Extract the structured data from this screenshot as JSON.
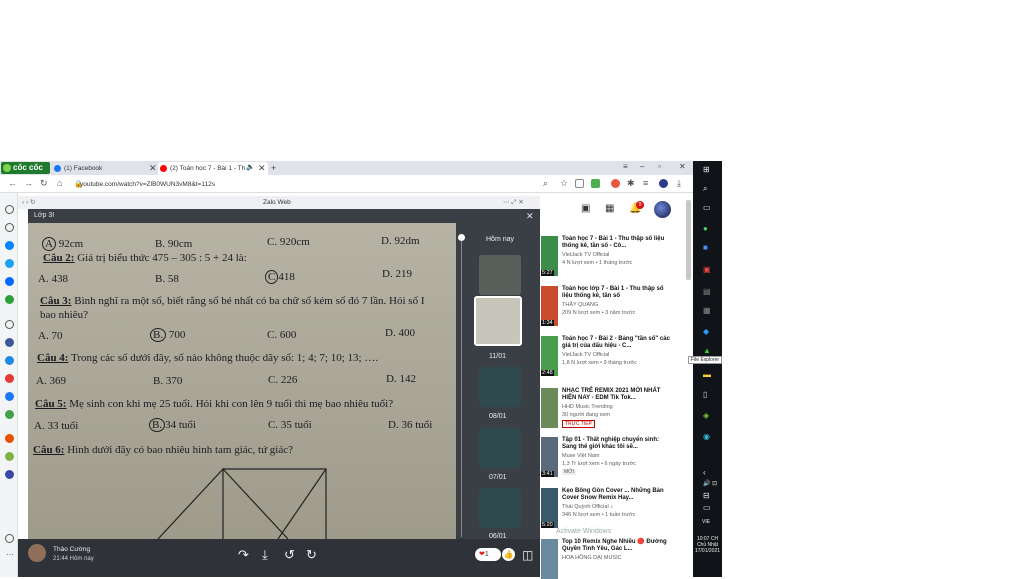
{
  "browser": {
    "brand": "cốc cốc",
    "tabs": [
      {
        "label": "(1) Facebook",
        "color": "#1877f2"
      },
      {
        "label": "(2) Toán học 7 - Bài 1 - Th",
        "color": "#ff0000"
      }
    ],
    "url": "youtube.com/watch?v=ZlB0WUN3vM8&t=112s"
  },
  "zalo": {
    "window_title": "Zalo Web",
    "conversation_title": "Lớp 3I",
    "sender": "Thảo Cường",
    "time": "21:44 Hôm nay",
    "reaction_count": "1",
    "thumb_header": "Hôm nay",
    "thumb_dates": [
      "11/01",
      "08/01",
      "07/01",
      "06/01"
    ]
  },
  "worksheet": {
    "row0": [
      "92cm",
      "B. 90cm",
      "C. 920cm",
      "D. 92dm"
    ],
    "q2_label": "Câu 2:",
    "q2_text": "Giá trị biểu thức 475 – 305 : 5 + 24 là:",
    "q2_opts": [
      "A. 438",
      "B. 58",
      "418",
      "D. 219"
    ],
    "q3_label": "Câu 3:",
    "q3_text": "Bình nghĩ ra một số, biết rằng số bé nhất có ba chữ số kém số đó 7 lần. Hỏi số I",
    "q3_text2": "bao nhiêu?",
    "q3_opts": [
      "A. 70",
      "700",
      "C. 600",
      "D. 400"
    ],
    "q4_label": "Câu 4:",
    "q4_text": "Trong các số dưới đây, số nào không thuộc dãy số: 1; 4; 7; 10; 13; ….",
    "q4_opts": [
      "A. 369",
      "B.  370",
      "C. 226",
      "D. 142"
    ],
    "q5_label": "Câu 5:",
    "q5_text": "Mẹ sinh con khi mẹ 25 tuổi. Hỏi khi con lên 9 tuổi thì mẹ bao nhiêu tuổi?",
    "q5_opts": [
      "A. 33 tuổi",
      "34 tuổi",
      "C. 35 tuổi",
      "D. 36 tuổi"
    ],
    "q6_label": "Câu 6:",
    "q6_text": "Hình dưới đây có bao nhiêu hình tam giác, tứ giác?"
  },
  "youtube": {
    "videos": [
      {
        "title": "Toán học 7 - Bài 1 - Thu thập số liệu thống kê, tần số - Cô...",
        "channel": "VietJack TV Official",
        "meta": "4 N lượt xem • 1 tháng trước",
        "duration": "5:27"
      },
      {
        "title": "Toán học lớp 7 - Bài 1 - Thu thập số liệu thống kê, tần số",
        "channel": "THẦY QUANG",
        "meta": "209 N lượt xem • 3 năm trước",
        "duration": "1:34"
      },
      {
        "title": "Toán học 7 - Bài 2 - Bảng \"tần số\" các giá trị của dấu hiệu - C...",
        "channel": "VietJack TV Official",
        "meta": "1,8 N lượt xem • 9 tháng trước",
        "duration": "2:48"
      },
      {
        "title": "NHẠC TRẺ REMIX 2021 MỚI NHẤT HIỆN NAY - EDM Tik Tok...",
        "channel": "HHD Music Trending",
        "meta": "30 người đang xem",
        "badge": "TRỰC TIẾP"
      },
      {
        "title": "Tập 01 - Thất nghiệp chuyển sinh: Sang thế giới khác tôi sẽ...",
        "channel": "Muse Việt Nam",
        "meta": "1,3 Tr lượt xem • 6 ngày trước",
        "badge": "MỚI",
        "duration": "3:41"
      },
      {
        "title": "Kẹo Bông Gòn Cover ... Những Bản Cover Snow Remix Hay...",
        "channel": "Thái Quỳnh Official ♪",
        "meta": "346 N lượt xem • 1 tuần trước",
        "duration": "5:20"
      },
      {
        "title": "Top 10 Remix Nghe Nhiều 🔴 Đường Quyền Tình Yêu, Gác L...",
        "channel": "HOA HỒNG DẠI MUSIC",
        "meta": ""
      }
    ],
    "watermark": "Activate Windows",
    "watermark_sub": "s"
  },
  "taskbar": {
    "tooltip": "File Explorer",
    "lang": "VIE",
    "time": "10:07 CH",
    "day": "Chủ Nhật",
    "date": "17/01/2021"
  }
}
